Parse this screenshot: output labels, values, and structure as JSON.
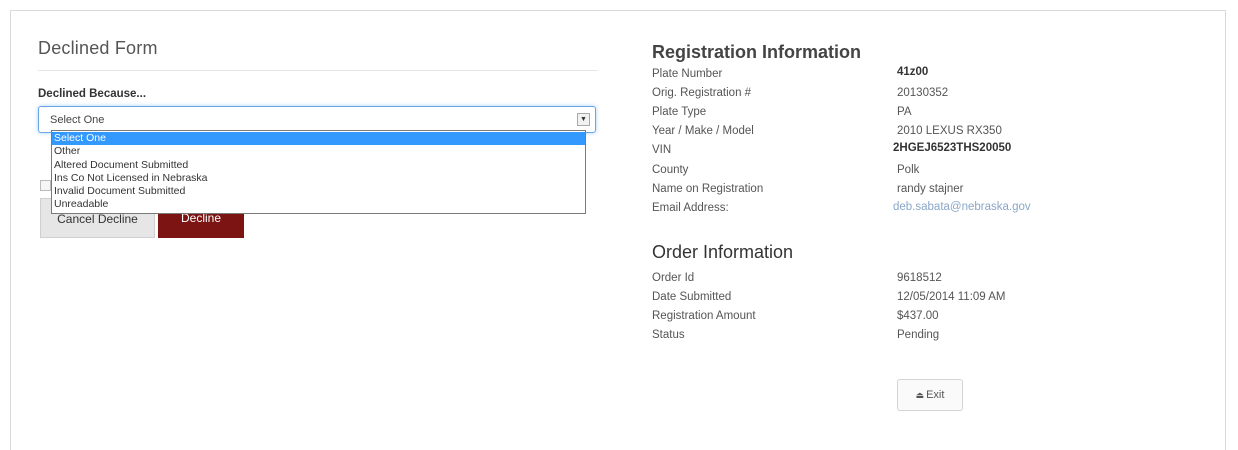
{
  "declined_form": {
    "title": "Declined Form",
    "field_label": "Declined Because...",
    "select_value": "Select One",
    "options": [
      {
        "label": "Select One",
        "selected": true
      },
      {
        "label": "Other",
        "selected": false
      },
      {
        "label": "Altered Document Submitted",
        "selected": false
      },
      {
        "label": "Ins Co Not Licensed in Nebraska",
        "selected": false
      },
      {
        "label": "Invalid Document Submitted",
        "selected": false
      },
      {
        "label": "Unreadable",
        "selected": false
      }
    ],
    "cancel_label": "Cancel Decline",
    "decline_label": "Decline",
    "decline_color": "#7d1414",
    "highlight_color": "#3399ff"
  },
  "registration": {
    "title": "Registration Information",
    "fields": [
      {
        "label": "Plate Number",
        "value": "41z00"
      },
      {
        "label": "Orig. Registration #",
        "value": "20130352"
      },
      {
        "label": "Plate Type",
        "value": "PA"
      },
      {
        "label": "Year / Make / Model",
        "value": "2010 LEXUS RX350"
      },
      {
        "label": "VIN",
        "value": "2HGEJ6523THS20050"
      },
      {
        "label": "County",
        "value": "Polk"
      },
      {
        "label": "Name on Registration",
        "value": "randy stajner"
      },
      {
        "label": "Email Address:",
        "value": "deb.sabata@nebraska.gov"
      }
    ]
  },
  "order": {
    "title": "Order Information",
    "fields": [
      {
        "label": "Order Id",
        "value": "9618512"
      },
      {
        "label": "Date Submitted",
        "value": "12/05/2014 11:09 AM"
      },
      {
        "label": "Registration Amount",
        "value": "$437.00"
      },
      {
        "label": "Status",
        "value": "Pending"
      }
    ]
  },
  "exit_label": "Exit",
  "icons": {
    "select_arrow": "chevron-down-icon",
    "exit": "eject-icon"
  }
}
